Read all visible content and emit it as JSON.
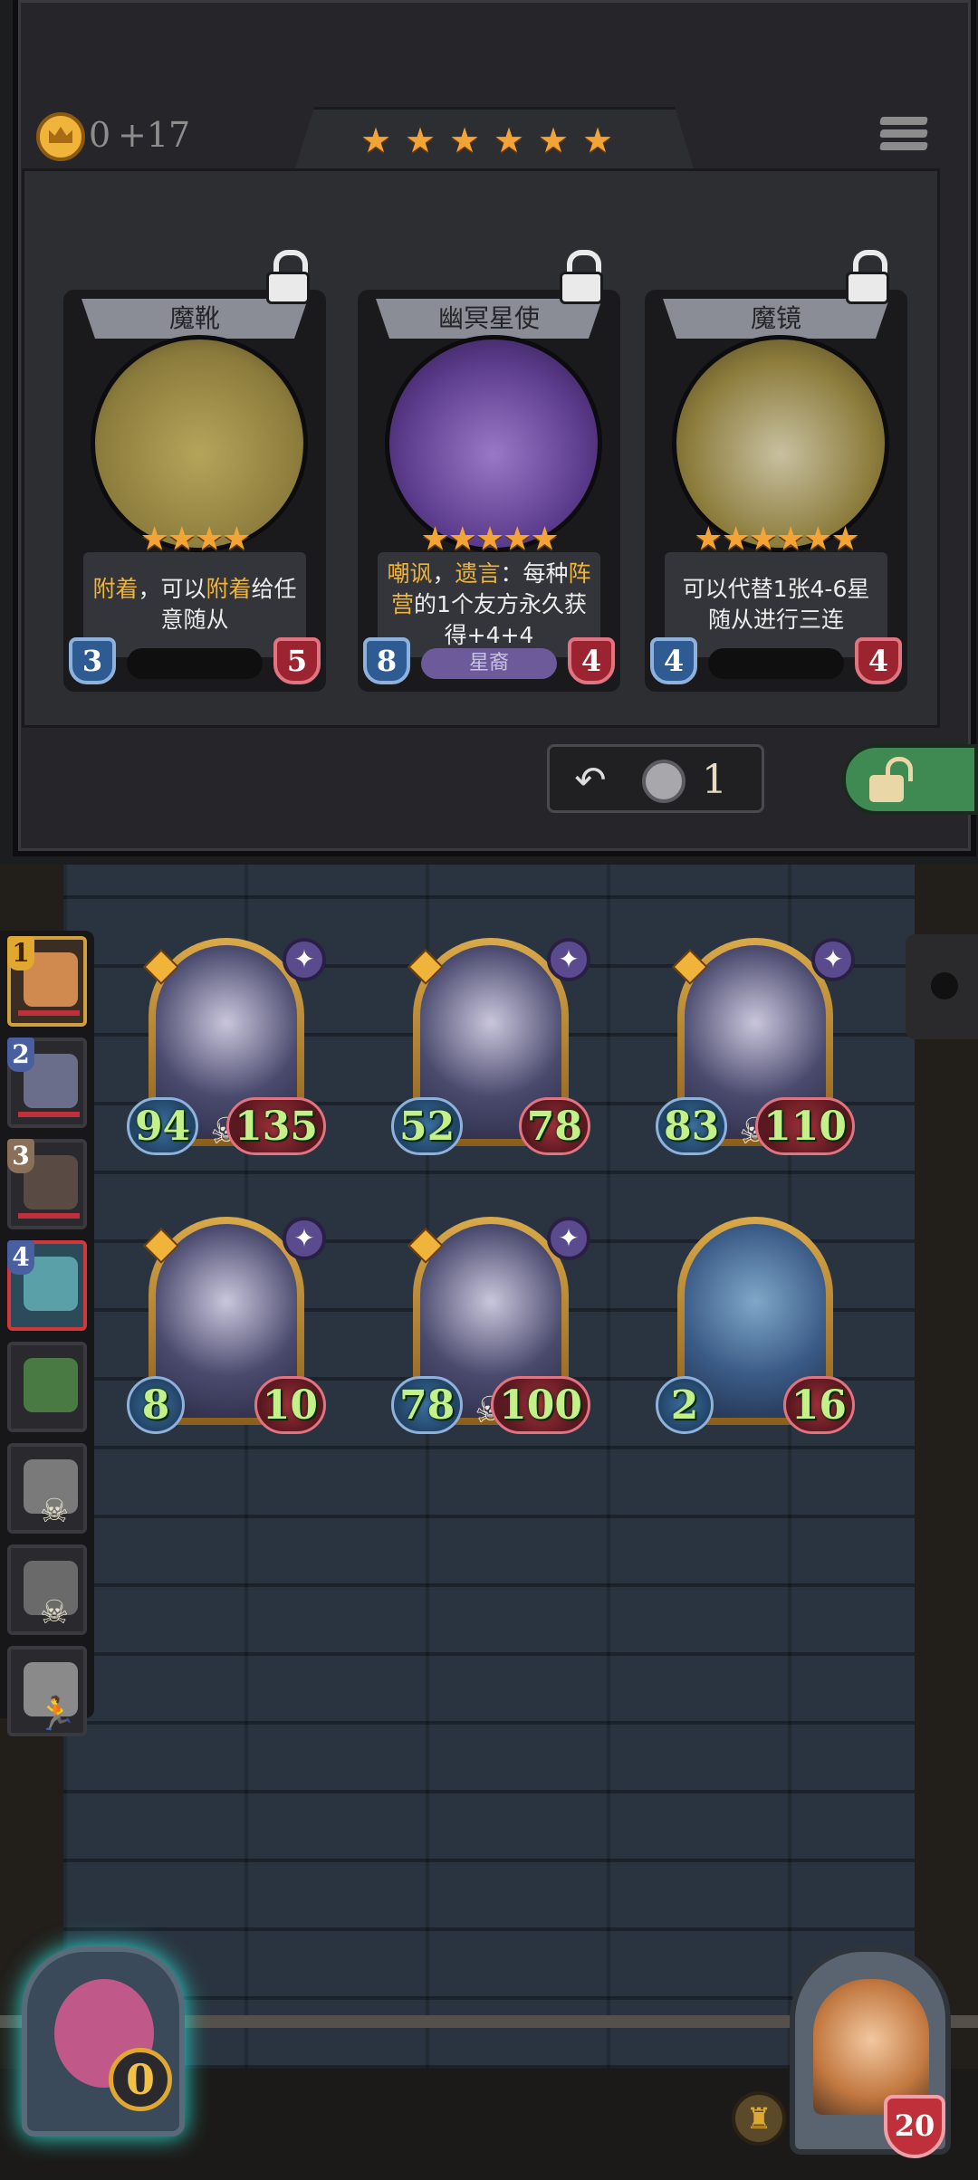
{
  "header": {
    "gold": "0",
    "gold_income": "+17",
    "tier_stars": 6
  },
  "shop_cards": [
    {
      "name": "魔靴",
      "stars": "★★★★",
      "desc_parts": [
        [
          "附着",
          true
        ],
        [
          "，可以",
          false
        ],
        [
          "附着",
          true
        ],
        [
          "给任意随从",
          false
        ]
      ],
      "attack": "3",
      "health": "5",
      "tribe": ""
    },
    {
      "name": "幽冥星使",
      "stars": "★★★★★",
      "desc_parts": [
        [
          "嘲讽",
          true
        ],
        [
          "，",
          false
        ],
        [
          "遗言",
          true
        ],
        [
          "：每种",
          false
        ],
        [
          "阵营",
          true
        ],
        [
          "的1个友方永久获得+4+4",
          false
        ]
      ],
      "attack": "8",
      "health": "4",
      "tribe": "星裔"
    },
    {
      "name": "魔镜",
      "stars": "★★★★★★",
      "desc_parts": [
        [
          "可以代替1张4-6星随从进行三连",
          false
        ]
      ],
      "attack": "4",
      "health": "4",
      "tribe": ""
    }
  ],
  "controls": {
    "refresh_cost": "1"
  },
  "opponents": [
    {
      "num": "1",
      "kind": "me"
    },
    {
      "num": "2",
      "kind": "normal"
    },
    {
      "num": "3",
      "kind": "normal"
    },
    {
      "num": "4",
      "kind": "current"
    },
    {
      "num": "",
      "kind": "normal"
    },
    {
      "num": "",
      "kind": "dead"
    },
    {
      "num": "",
      "kind": "dead"
    },
    {
      "num": "",
      "kind": "fled"
    }
  ],
  "board_minions": [
    {
      "attack": "94",
      "health": "135",
      "skull": true
    },
    {
      "attack": "52",
      "health": "78",
      "skull": false
    },
    {
      "attack": "83",
      "health": "110",
      "skull": true
    },
    {
      "attack": "8",
      "health": "10",
      "skull": false
    },
    {
      "attack": "78",
      "health": "100",
      "skull": true
    },
    {
      "attack": "2",
      "health": "16",
      "skull": false
    }
  ],
  "treasure": {
    "count": "0"
  },
  "hero": {
    "health": "20"
  },
  "colors": {
    "gold_star": "#f3a436",
    "keyword": "#f0b43a",
    "stat_green": "#c4f08a",
    "treasure_glow": "#2fe0d8"
  }
}
